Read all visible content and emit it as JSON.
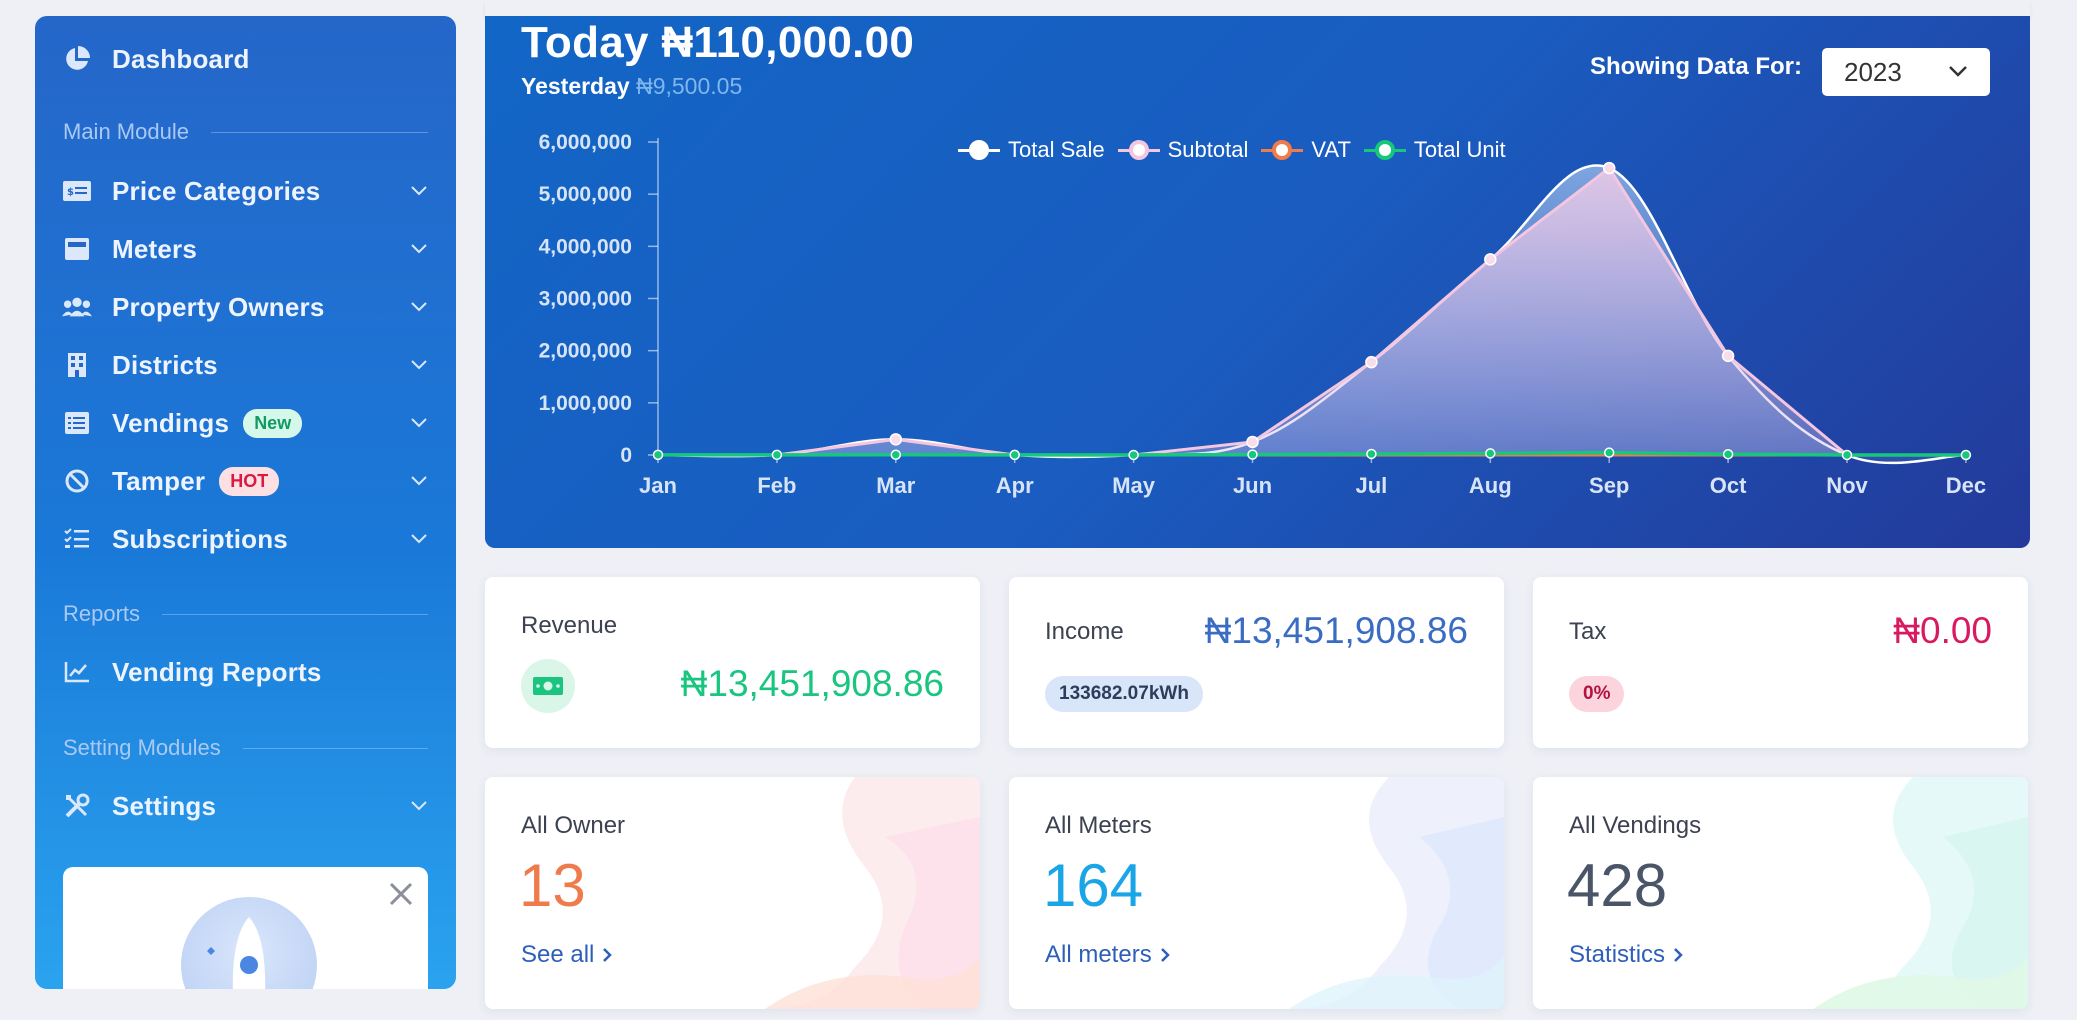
{
  "sidebar": {
    "dashboard_label": "Dashboard",
    "sections": {
      "main": "Main Module",
      "reports": "Reports",
      "settings": "Setting Modules"
    },
    "items": [
      {
        "label": "Price Categories",
        "icon": "price-tag-icon"
      },
      {
        "label": "Meters",
        "icon": "meter-icon"
      },
      {
        "label": "Property Owners",
        "icon": "users-icon"
      },
      {
        "label": "Districts",
        "icon": "building-icon"
      },
      {
        "label": "Vendings",
        "icon": "list-icon",
        "badge": "New"
      },
      {
        "label": "Tamper",
        "icon": "ban-icon",
        "badge": "HOT"
      },
      {
        "label": "Subscriptions",
        "icon": "checklist-icon"
      }
    ],
    "report_items": [
      {
        "label": "Vending Reports",
        "icon": "line-chart-icon"
      }
    ],
    "setting_items": [
      {
        "label": "Settings",
        "icon": "tools-icon"
      }
    ]
  },
  "header": {
    "today_label": "Today",
    "today_value": "₦110,000.00",
    "yesterday_label": "Yesterday",
    "yesterday_value": "₦9,500.05",
    "showing_label": "Showing Data For:",
    "year_selected": "2023"
  },
  "chart_data": {
    "type": "area",
    "categories": [
      "Jan",
      "Feb",
      "Mar",
      "Apr",
      "May",
      "Jun",
      "Jul",
      "Aug",
      "Sep",
      "Oct",
      "Nov",
      "Dec"
    ],
    "ylim": [
      0,
      6000000
    ],
    "yticks": [
      "0",
      "1,000,000",
      "2,000,000",
      "3,000,000",
      "4,000,000",
      "5,000,000",
      "6,000,000"
    ],
    "ytick_values": [
      0,
      1000000,
      2000000,
      3000000,
      4000000,
      5000000,
      6000000
    ],
    "series": [
      {
        "name": "Total Sale",
        "color": "#ffffff",
        "values": [
          0,
          0,
          300000,
          0,
          0,
          250000,
          1780000,
          3750000,
          5500000,
          1900000,
          0,
          0
        ]
      },
      {
        "name": "Subtotal",
        "color": "#f4c6e0",
        "values": [
          0,
          0,
          300000,
          0,
          0,
          250000,
          1780000,
          3750000,
          5500000,
          1900000,
          0,
          0
        ]
      },
      {
        "name": "VAT",
        "color": "#f07b4b",
        "values": [
          0,
          0,
          0,
          0,
          0,
          0,
          0,
          0,
          0,
          0,
          0,
          0
        ]
      },
      {
        "name": "Total Unit",
        "color": "#17c77b",
        "values": [
          2000,
          3000,
          5000,
          2000,
          1000,
          8000,
          20000,
          30000,
          45000,
          15000,
          500,
          0
        ]
      }
    ],
    "legend": "top-center",
    "grid": false
  },
  "cards": {
    "revenue": {
      "title": "Revenue",
      "value": "₦13,451,908.86",
      "icon": "money-icon"
    },
    "income": {
      "title": "Income",
      "value": "₦13,451,908.86",
      "pill": "133682.07kWh"
    },
    "tax": {
      "title": "Tax",
      "value": "₦0.00",
      "pill": "0%"
    },
    "owners": {
      "title": "All Owner",
      "value": "13",
      "link": "See all"
    },
    "meters": {
      "title": "All Meters",
      "value": "164",
      "link": "All meters"
    },
    "vendings": {
      "title": "All Vendings",
      "value": "428",
      "link": "Statistics"
    }
  },
  "colors": {
    "green": "#19c57f",
    "income_blue": "#3a6cc4",
    "tax_red": "#d81b60",
    "owner_orange": "#ef7b4c",
    "meter_cyan": "#1aa6e6",
    "vending_slate": "#4a5568"
  }
}
